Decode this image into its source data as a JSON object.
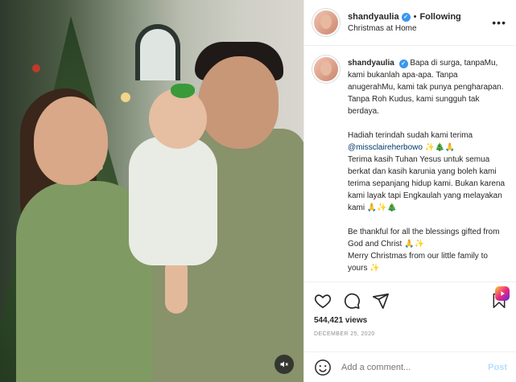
{
  "header": {
    "username": "shandyaulia",
    "separator": "•",
    "follow_state": "Following",
    "location": "Christmas at Home",
    "more": "•••"
  },
  "caption": {
    "username": "shandyaulia",
    "p1": "Bapa di surga, tanpaMu, kami bukanlah apa-apa. Tanpa anugerahMu, kami tak punya pengharapan. Tanpa Roh Kudus, kami sungguh tak berdaya.",
    "p2_line1": "Hadiah terindah sudah kami terima",
    "mention": "@missclaireherbowo",
    "p2_rest": "Terima kasih Tuhan Yesus untuk semua berkat dan kasih karunia yang boleh kami terima sepanjang hidup kami. Bukan karena kami layak tapi Engkaulah yang melayakan kami",
    "emoji_1": "✨🎄🙏",
    "emoji_2": "🙏✨🎄",
    "p3": "Be thankful for all the blessings gifted from God and Christ",
    "emoji_3": "🙏✨",
    "p4": "Merry Christmas from our little family to yours",
    "emoji_4": "✨"
  },
  "stats": {
    "views": "544,421 views",
    "date": "DECEMBER 25, 2020"
  },
  "comment": {
    "placeholder": "Add a comment...",
    "post_label": "Post"
  },
  "icons": {
    "like": "heart-icon",
    "comment": "comment-icon",
    "share": "send-icon",
    "save": "bookmark-icon",
    "audio": "speaker-muted-icon",
    "emoji": "smiley-icon"
  },
  "colors": {
    "verified": "#3897f0",
    "mention": "#00376b",
    "post_disabled": "#b2dffc"
  }
}
